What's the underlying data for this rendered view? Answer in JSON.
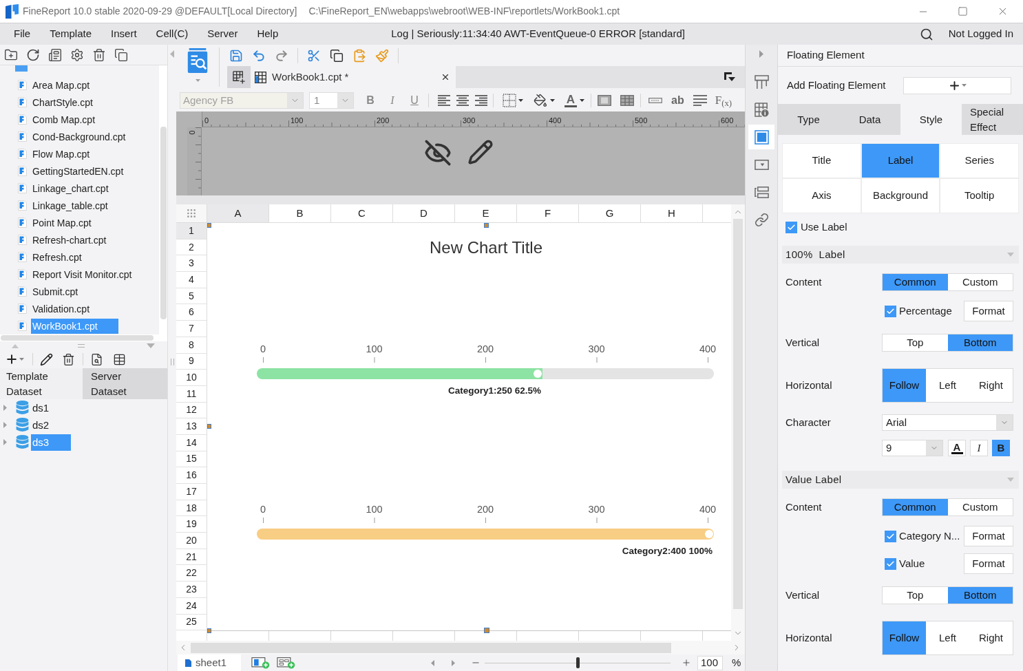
{
  "window": {
    "title": "FineReport 10.0 stable 2020-09-29 @DEFAULT[Local Directory]",
    "path": "C:\\FineReport_EN\\webapps\\webroot\\WEB-INF\\reportlets/WorkBook1.cpt"
  },
  "menu_bar": {
    "items": [
      "File",
      "Template",
      "Insert",
      "Cell(C)",
      "Server",
      "Help"
    ],
    "log": "Log | Seriously:11:34:40 AWT-EventQueue-0 ERROR [standard]",
    "login": "Not Logged In"
  },
  "template_tree": {
    "items": [
      {
        "label": "Area Map.cpt",
        "selected": false
      },
      {
        "label": "ChartStyle.cpt",
        "selected": false
      },
      {
        "label": "Comb Map.cpt",
        "selected": false
      },
      {
        "label": "Cond-Background.cpt",
        "selected": false
      },
      {
        "label": "Flow Map.cpt",
        "selected": false
      },
      {
        "label": "GettingStartedEN.cpt",
        "selected": false
      },
      {
        "label": "Linkage_chart.cpt",
        "selected": false
      },
      {
        "label": "Linkage_table.cpt",
        "selected": false
      },
      {
        "label": "Point Map.cpt",
        "selected": false
      },
      {
        "label": "Refresh-chart.cpt",
        "selected": false
      },
      {
        "label": "Refresh.cpt",
        "selected": false
      },
      {
        "label": "Report Visit Monitor.cpt",
        "selected": false
      },
      {
        "label": "Submit.cpt",
        "selected": false
      },
      {
        "label": "Validation.cpt",
        "selected": false
      },
      {
        "label": "WorkBook1.cpt",
        "selected": true
      }
    ]
  },
  "dataset_panel": {
    "tabs": [
      {
        "label": "Template Dataset",
        "selected": true
      },
      {
        "label": "Server Dataset",
        "selected": false
      }
    ],
    "datasets": [
      {
        "label": "ds1",
        "expanded": false,
        "selected": false
      },
      {
        "label": "ds2",
        "expanded": false,
        "selected": false
      },
      {
        "label": "ds3",
        "expanded": false,
        "selected": true
      }
    ]
  },
  "editor": {
    "sheet_tab": {
      "label": "WorkBook1.cpt *"
    },
    "format_toolbar": {
      "font": {
        "value": "Agency FB",
        "disabled": true
      },
      "size": {
        "value": "1",
        "disabled": true
      },
      "style_buttons": [
        {
          "kind": "bold",
          "label": "B"
        },
        {
          "kind": "italic",
          "label": "I"
        },
        {
          "kind": "underline",
          "label": "U"
        }
      ],
      "font_color": "A",
      "text_button": "ab",
      "formula_button": "F$_{(x)}$"
    },
    "ruler": {
      "marks": [
        "0",
        "100",
        "200",
        "300",
        "400",
        "500",
        "600"
      ],
      "side_mark": "0"
    },
    "columns": [
      {
        "label": "A",
        "selected": true
      },
      {
        "label": "B",
        "selected": false
      },
      {
        "label": "C",
        "selected": false
      },
      {
        "label": "D",
        "selected": false
      },
      {
        "label": "E",
        "selected": false
      },
      {
        "label": "F",
        "selected": false
      },
      {
        "label": "G",
        "selected": false
      },
      {
        "label": "H",
        "selected": false
      }
    ],
    "rows": [
      {
        "label": "1",
        "selected": true
      },
      {
        "label": "2",
        "selected": false
      },
      {
        "label": "3",
        "selected": false
      },
      {
        "label": "4",
        "selected": false
      },
      {
        "label": "5",
        "selected": false
      },
      {
        "label": "6",
        "selected": false
      },
      {
        "label": "7",
        "selected": false
      },
      {
        "label": "8",
        "selected": false
      },
      {
        "label": "9",
        "selected": false
      },
      {
        "label": "10",
        "selected": false
      },
      {
        "label": "11",
        "selected": false
      },
      {
        "label": "12",
        "selected": false
      },
      {
        "label": "13",
        "selected": false
      },
      {
        "label": "14",
        "selected": false
      },
      {
        "label": "15",
        "selected": false
      },
      {
        "label": "16",
        "selected": false
      },
      {
        "label": "17",
        "selected": false
      },
      {
        "label": "18",
        "selected": false
      },
      {
        "label": "19",
        "selected": false
      },
      {
        "label": "20",
        "selected": false
      },
      {
        "label": "21",
        "selected": false
      },
      {
        "label": "22",
        "selected": false
      },
      {
        "label": "23",
        "selected": false
      },
      {
        "label": "24",
        "selected": false
      },
      {
        "label": "25",
        "selected": false
      }
    ],
    "chart": {
      "title": "New Chart Title",
      "gauges": [
        {
          "ticks": [
            "0",
            "100",
            "200",
            "300",
            "400"
          ],
          "level": 0.625,
          "color": "#8de3a3",
          "label": "Category1:250 62.5%"
        },
        {
          "ticks": [
            "0",
            "100",
            "200",
            "300",
            "400"
          ],
          "level": 1,
          "color": "#f8cd84",
          "label": "Category2:400 100%"
        }
      ]
    },
    "sheet_name": "sheet1",
    "zoom": {
      "level": 0.5,
      "value": "100",
      "unit": "%"
    }
  },
  "side_tabs": [
    {
      "kind": "columns",
      "selected": false
    },
    {
      "kind": "cell_info",
      "selected": false
    },
    {
      "kind": "frame",
      "selected": true
    },
    {
      "kind": "dropdown",
      "selected": false
    },
    {
      "kind": "stack",
      "selected": false
    },
    {
      "kind": "link",
      "selected": false
    }
  ],
  "properties": {
    "title": "Floating Element",
    "add_element": {
      "label": "Add Floating Element"
    },
    "tabs": [
      {
        "label": "Type",
        "selected": false
      },
      {
        "label": "Data",
        "selected": false
      },
      {
        "label": "Style",
        "selected": true
      },
      {
        "label": "Special Effect",
        "selected": false
      }
    ],
    "style_tabs": [
      {
        "label": "Title",
        "selected": false
      },
      {
        "label": "Label",
        "selected": true
      },
      {
        "label": "Series",
        "selected": false
      },
      {
        "label": "Axis",
        "selected": false
      },
      {
        "label": "Background",
        "selected": false
      },
      {
        "label": "Tooltip",
        "selected": false
      }
    ],
    "use_label": {
      "label": "Use Label",
      "checked": true
    },
    "sections": [
      {
        "title": "100%  Label",
        "expanded": true,
        "rows": [
          {
            "kind": "segmented",
            "label": "Content",
            "options": [
              {
                "label": "Common",
                "selected": true
              },
              {
                "label": "Custom",
                "selected": false
              }
            ]
          },
          {
            "kind": "check",
            "label": "Percentage",
            "checked": true,
            "button": "Format"
          },
          {
            "kind": "segmented",
            "label": "Vertical",
            "options": [
              {
                "label": "Top",
                "selected": false
              },
              {
                "label": "Bottom",
                "selected": true
              }
            ]
          },
          {
            "kind": "segmented",
            "label": "Horizontal",
            "options": [
              {
                "label": "Follow",
                "selected": true
              },
              {
                "label": "Left",
                "selected": false
              },
              {
                "label": "Right",
                "selected": false
              }
            ]
          },
          {
            "kind": "select",
            "label": "Character",
            "value": "Arial"
          },
          {
            "kind": "font",
            "size": "9",
            "color_button": "A",
            "buttons": [
              {
                "kind": "italic",
                "label": "I",
                "selected": false
              },
              {
                "kind": "bold",
                "label": "B",
                "selected": true
              }
            ]
          }
        ]
      },
      {
        "title": "Value Label",
        "expanded": true,
        "rows": [
          {
            "kind": "segmented",
            "label": "Content",
            "options": [
              {
                "label": "Common",
                "selected": true
              },
              {
                "label": "Custom",
                "selected": false
              }
            ]
          },
          {
            "kind": "check",
            "label": "Category N...",
            "checked": true,
            "button": "Format"
          },
          {
            "kind": "check",
            "label": "Value",
            "checked": true,
            "button": "Format"
          },
          {
            "kind": "segmented",
            "label": "Vertical",
            "options": [
              {
                "label": "Top",
                "selected": false
              },
              {
                "label": "Bottom",
                "selected": true
              }
            ]
          },
          {
            "kind": "segmented",
            "label": "Horizontal",
            "options": [
              {
                "label": "Follow",
                "selected": true
              },
              {
                "label": "Left",
                "selected": false
              },
              {
                "label": "Right",
                "selected": false
              }
            ]
          }
        ]
      }
    ]
  }
}
